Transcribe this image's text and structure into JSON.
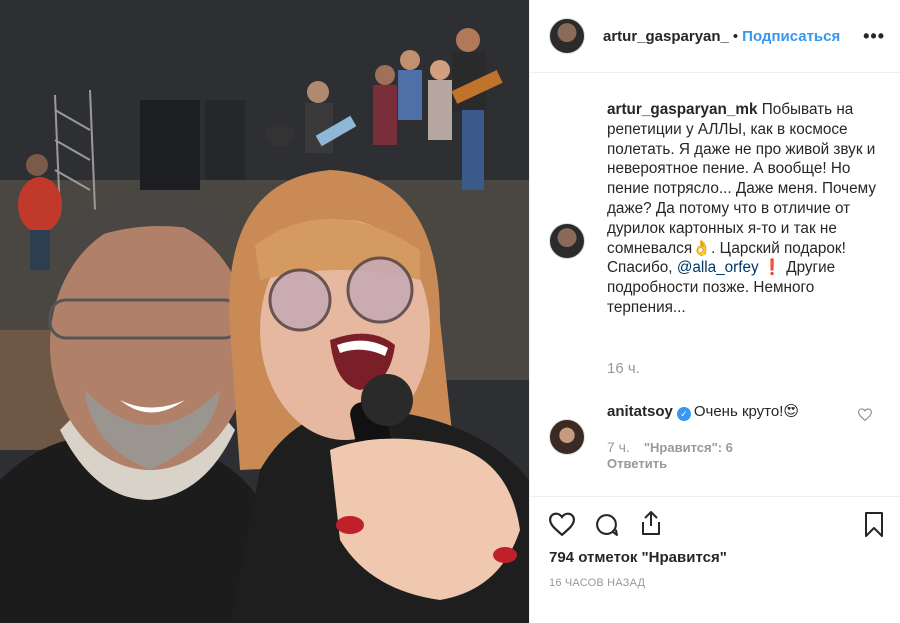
{
  "header": {
    "username": "artur_gasparyan_",
    "separator": "•",
    "follow_label": "Подписаться",
    "more_label": "•••"
  },
  "caption": {
    "author": "artur_gasparyan_mk",
    "text_part1": " Побывать на репетиции у АЛЛЫ, как в космосе полетать. Я даже не про живой звук и невероятное пение. А вообще! Но пение потрясло... Даже меня. Почему даже? Да потому что в отличие от дурилок картонных я-то и так не сомневался",
    "emoji1": "👌",
    "text_part2": ". Царский подарок! Спасибо, ",
    "mention": "@alla_orfey",
    "emoji2": "❗",
    "text_part3": " Другие подробности позже. Немного терпения...",
    "time": "16 ч."
  },
  "comment": {
    "author": "anitatsoy",
    "verified_mark": "✓",
    "text": "Очень круто!",
    "emoji": "😍",
    "time": "7 ч.",
    "likes": "\"Нравится\": 6",
    "reply_label": "Ответить"
  },
  "footer": {
    "likes_total": "794 отметок \"Нравится\"",
    "posted": "16 ЧАСОВ НАЗАД"
  },
  "icons": [
    "heart-icon",
    "comment-icon",
    "share-icon",
    "bookmark-icon",
    "small-heart-icon"
  ],
  "colors": {
    "link": "#3897f0",
    "mention": "#00376b",
    "muted": "#999999",
    "text": "#262626"
  }
}
